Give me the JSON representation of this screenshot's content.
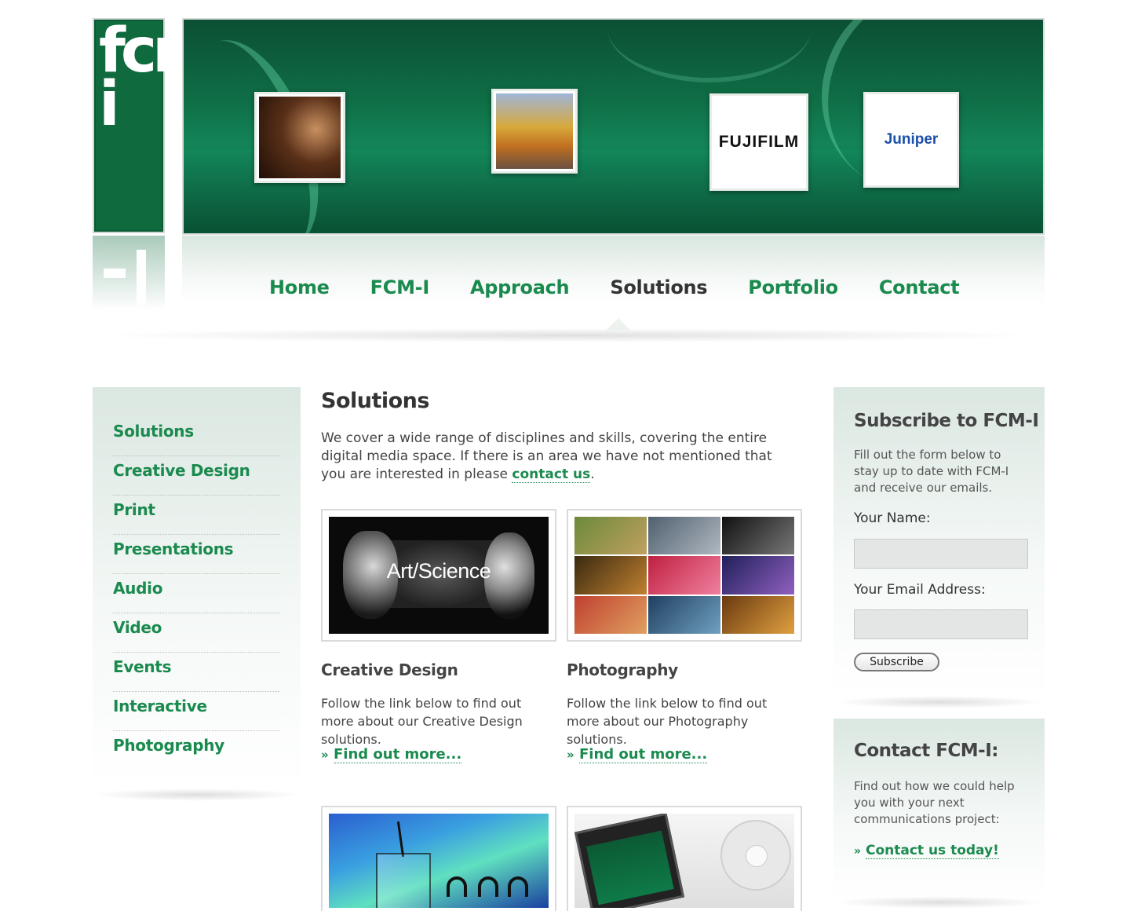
{
  "logo": {
    "text": "fcm-i"
  },
  "banner": {
    "logos": [
      "FUJIFILM",
      "Juniper"
    ]
  },
  "nav": {
    "items": [
      {
        "label": "Home",
        "active": false
      },
      {
        "label": "FCM-I",
        "active": false
      },
      {
        "label": "Approach",
        "active": false
      },
      {
        "label": "Solutions",
        "active": true
      },
      {
        "label": "Portfolio",
        "active": false
      },
      {
        "label": "Contact",
        "active": false
      }
    ]
  },
  "sidebar": {
    "items": [
      "Solutions",
      "Creative Design",
      "Print",
      "Presentations",
      "Audio",
      "Video",
      "Events",
      "Interactive",
      "Photography"
    ]
  },
  "main": {
    "title": "Solutions",
    "intro_text": "We cover a wide range of disciplines and skills, covering the entire digital media space. If there is an area we have not mentioned that you are interested in please ",
    "intro_link": "contact us",
    "intro_end": ".",
    "cards": [
      {
        "title": "Creative Design",
        "image_label": "Art/Science",
        "desc": "Follow the link below to find out more about our Creative Design solutions.",
        "link": "Find out more..."
      },
      {
        "title": "Photography",
        "desc": "Follow the link below to find out more about our Photography solutions.",
        "link": "Find out more..."
      }
    ],
    "link_prefix": "»"
  },
  "subscribe": {
    "title": "Subscribe to FCM-I",
    "text": "Fill out the form below to stay up to date with FCM-I and receive our emails.",
    "name_label": "Your Name:",
    "email_label": "Your Email Address:",
    "button": "Subscribe"
  },
  "contact": {
    "title": "Contact FCM-I:",
    "text": "Find out how we could help you with your next communications project:",
    "link": "Contact us today!"
  },
  "colors": {
    "brand_green": "#1a8a4e",
    "logo_green": "#0f6a3e",
    "text": "#444444"
  }
}
